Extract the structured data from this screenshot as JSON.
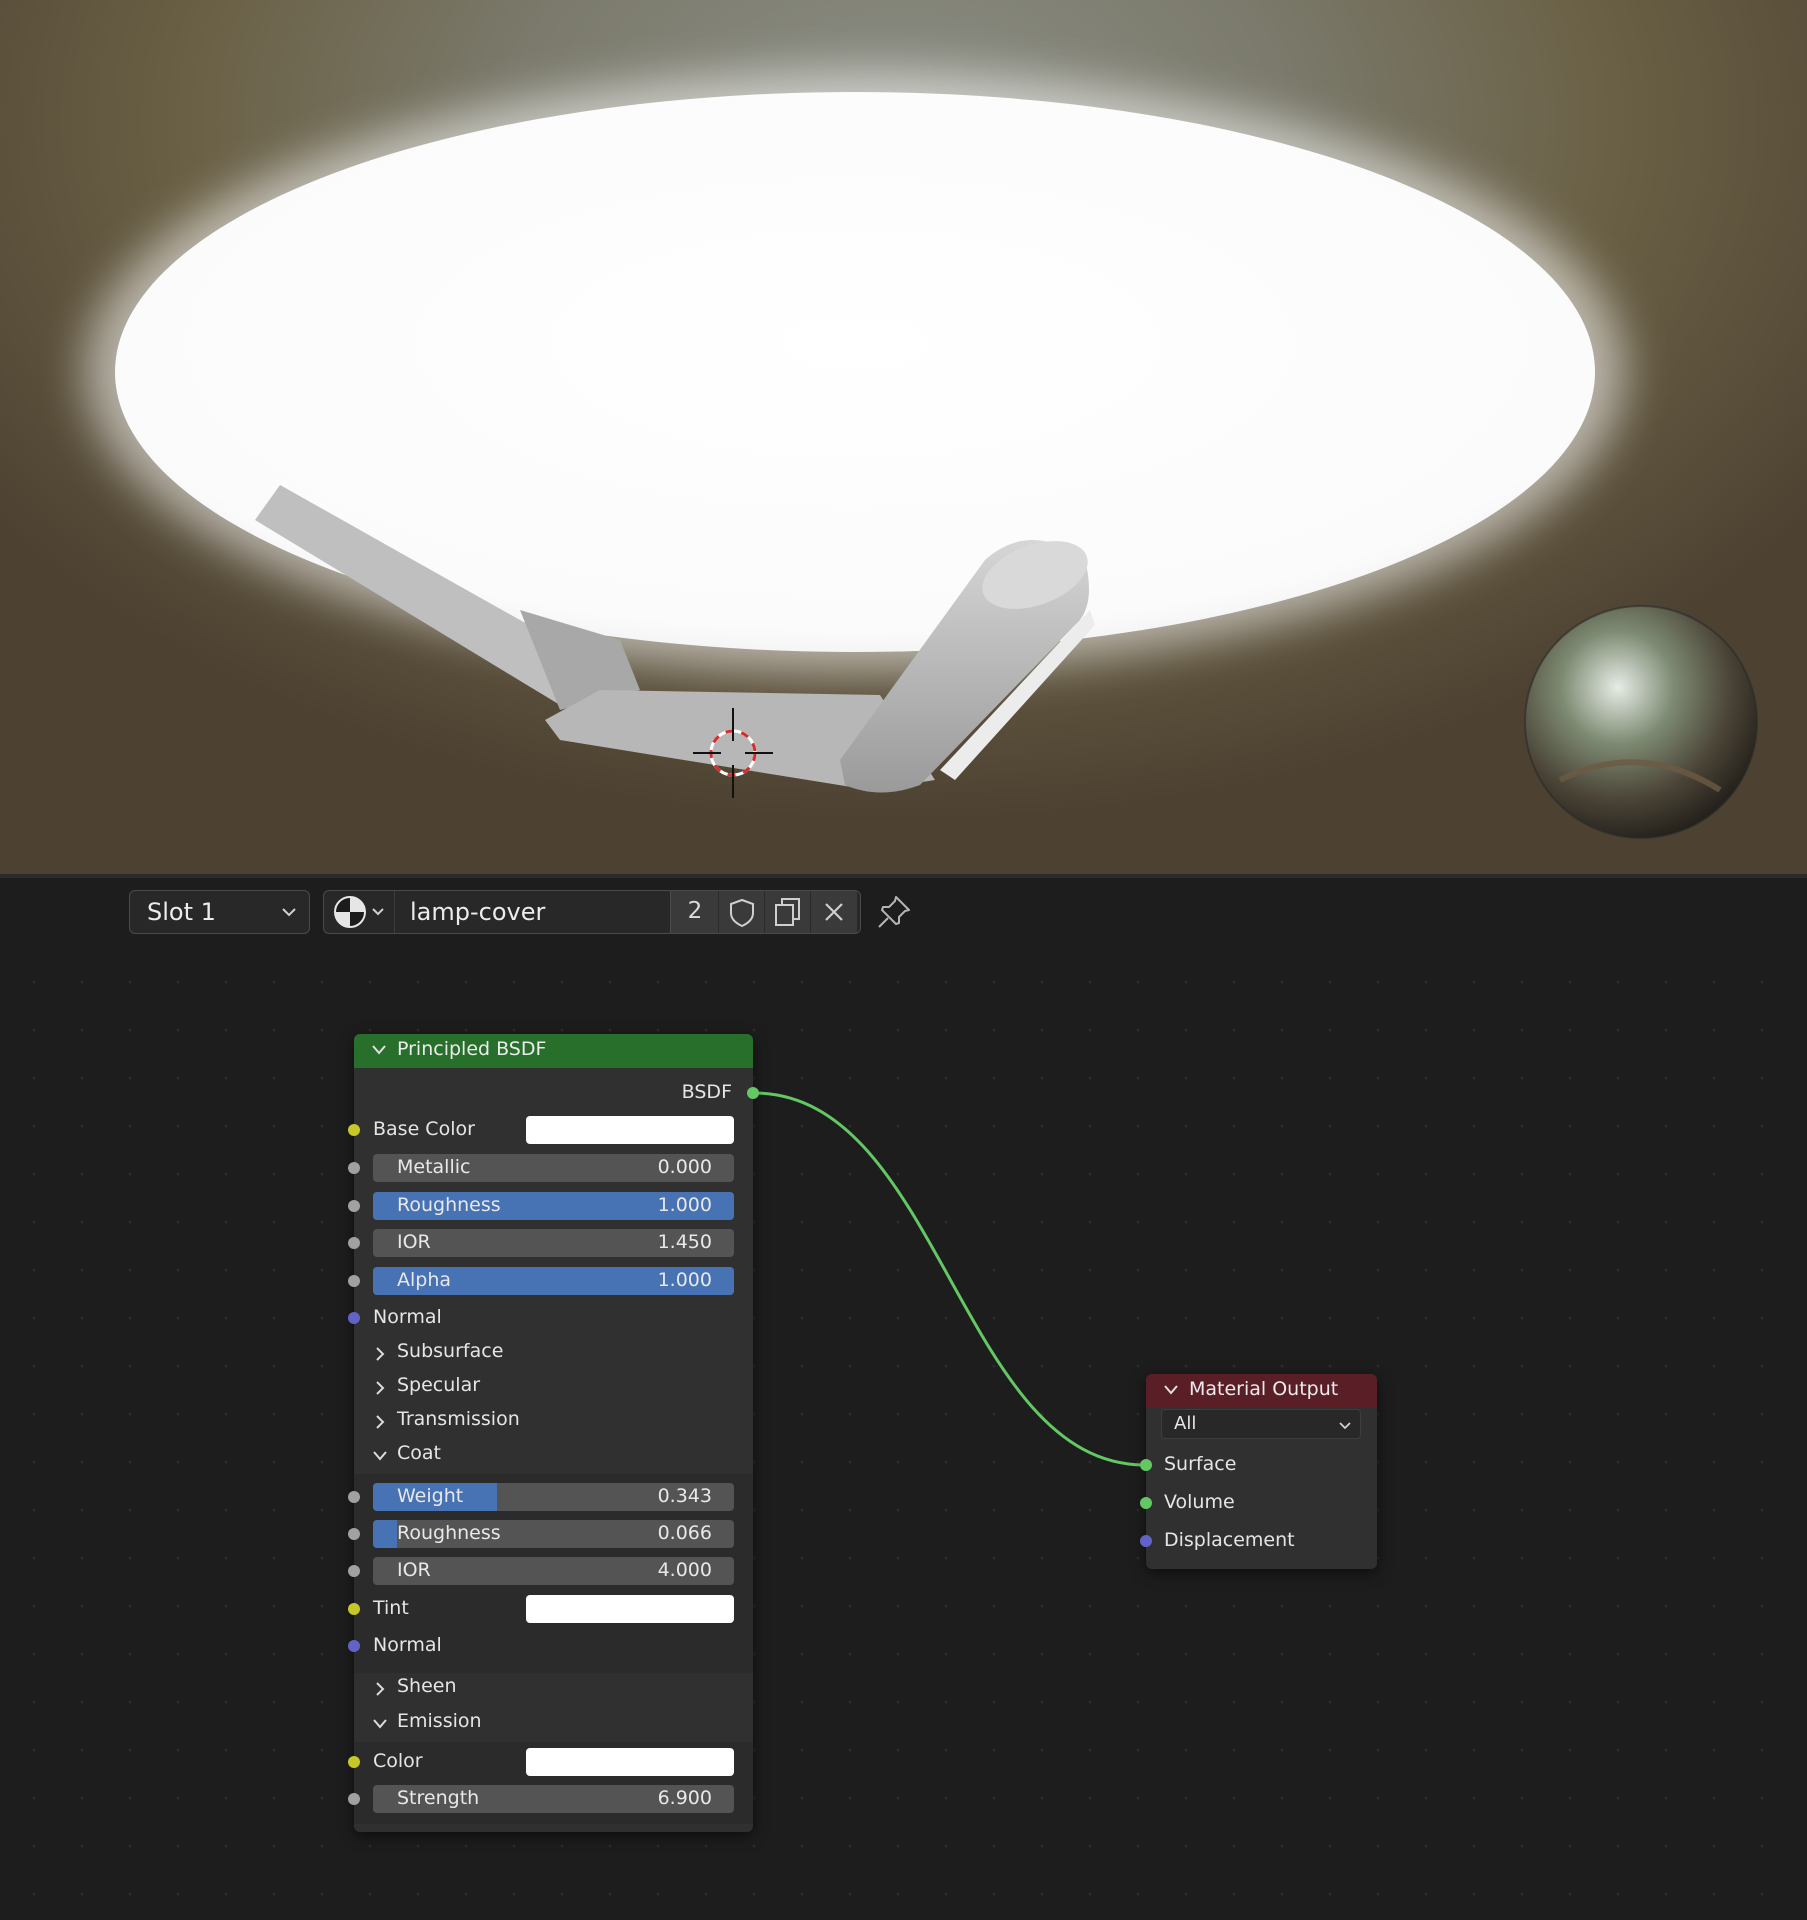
{
  "toolbar": {
    "slot_label": "Slot 1",
    "material_name": "lamp-cover",
    "user_count": "2"
  },
  "bsdf_node": {
    "title": "Principled BSDF",
    "output": "BSDF",
    "base_color": {
      "label": "Base Color",
      "value": "#ffffff"
    },
    "metallic": {
      "label": "Metallic",
      "value": "0.000",
      "fraction": 0.0
    },
    "roughness": {
      "label": "Roughness",
      "value": "1.000",
      "fraction": 1.0
    },
    "ior": {
      "label": "IOR",
      "value": "1.450",
      "fraction": 0.0
    },
    "alpha": {
      "label": "Alpha",
      "value": "1.000",
      "fraction": 1.0
    },
    "normal": "Normal",
    "panels": {
      "subsurface": "Subsurface",
      "specular": "Specular",
      "transmission": "Transmission",
      "coat": "Coat",
      "sheen": "Sheen",
      "emission": "Emission"
    },
    "coat": {
      "weight": {
        "label": "Weight",
        "value": "0.343",
        "fraction": 0.343
      },
      "roughness": {
        "label": "Roughness",
        "value": "0.066",
        "fraction": 0.066
      },
      "ior": {
        "label": "IOR",
        "value": "4.000",
        "fraction": 0.0
      },
      "tint": {
        "label": "Tint",
        "value": "#ffffff"
      },
      "normal": "Normal"
    },
    "emission": {
      "color": {
        "label": "Color",
        "value": "#ffffff"
      },
      "strength": {
        "label": "Strength",
        "value": "6.900",
        "fraction": 0.0
      }
    }
  },
  "output_node": {
    "title": "Material Output",
    "target": "All",
    "inputs": [
      "Surface",
      "Volume",
      "Displacement"
    ]
  },
  "colors": {
    "bsdf_header": "#276f2b",
    "output_header": "#5a1e26",
    "slider_fill": "#4772b3",
    "link": "#63c763"
  }
}
